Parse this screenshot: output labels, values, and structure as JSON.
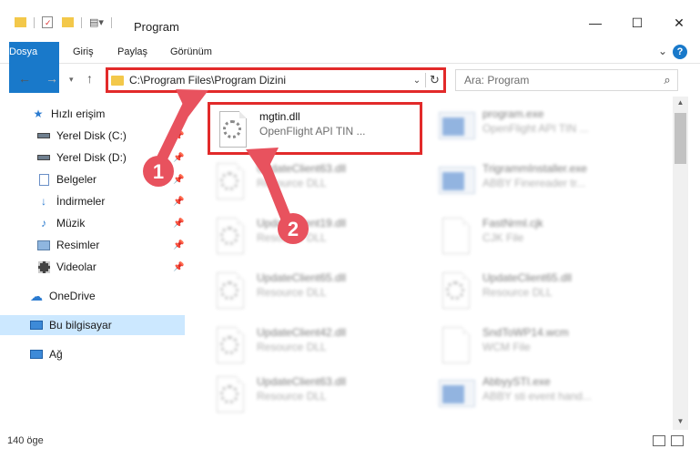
{
  "window": {
    "title": "Program",
    "minimize": "—",
    "maximize": "☐",
    "close": "✕"
  },
  "ribbon": {
    "tabs": [
      "Dosya",
      "Giriş",
      "Paylaş",
      "Görünüm"
    ],
    "help": "?"
  },
  "address": {
    "path": "C:\\Program Files\\Program Dizini",
    "search_placeholder": "Ara: Program"
  },
  "sidebar": {
    "items": [
      {
        "label": "Hızlı erişim",
        "icon": "star-icon"
      },
      {
        "label": "Yerel Disk (C:)",
        "icon": "drive-icon"
      },
      {
        "label": "Yerel Disk (D:)",
        "icon": "drive-icon"
      },
      {
        "label": "Belgeler",
        "icon": "documents-icon"
      },
      {
        "label": "İndirmeler",
        "icon": "download-icon"
      },
      {
        "label": "Müzik",
        "icon": "music-icon"
      },
      {
        "label": "Resimler",
        "icon": "pictures-icon"
      },
      {
        "label": "Videolar",
        "icon": "video-icon"
      },
      {
        "label": "OneDrive",
        "icon": "cloud-icon"
      },
      {
        "label": "Bu bilgisayar",
        "icon": "computer-icon"
      },
      {
        "label": "Ağ",
        "icon": "network-icon"
      }
    ]
  },
  "files": [
    {
      "name": "mgtin.dll",
      "type": "OpenFlight API TIN ..."
    },
    {
      "name": "program.exe",
      "type": "OpenFlight API TIN ..."
    },
    {
      "name": "UpdateClient63.dll",
      "type": "Resource DLL"
    },
    {
      "name": "TrigrammInstaller.exe",
      "type": "ABBY Finereader tr..."
    },
    {
      "name": "UpdateClient19.dll",
      "type": "Resource DLL"
    },
    {
      "name": "FastNrml.cjk",
      "type": "CJK File"
    },
    {
      "name": "UpdateClient65.dll",
      "type": "Resource DLL"
    },
    {
      "name": "UpdateClient65.dll",
      "type": "Resource DLL"
    },
    {
      "name": "UpdateClient42.dll",
      "type": "Resource DLL"
    },
    {
      "name": "SndToWP14.wcm",
      "type": "WCM File"
    },
    {
      "name": "UpdateClient63.dll",
      "type": "Resource DLL"
    },
    {
      "name": "AbbyySTI.exe",
      "type": "ABBY sti event hand..."
    }
  ],
  "status": {
    "count": "140 öge"
  },
  "annotations": {
    "step1": "1",
    "step2": "2",
    "color": "#e22a2a"
  }
}
